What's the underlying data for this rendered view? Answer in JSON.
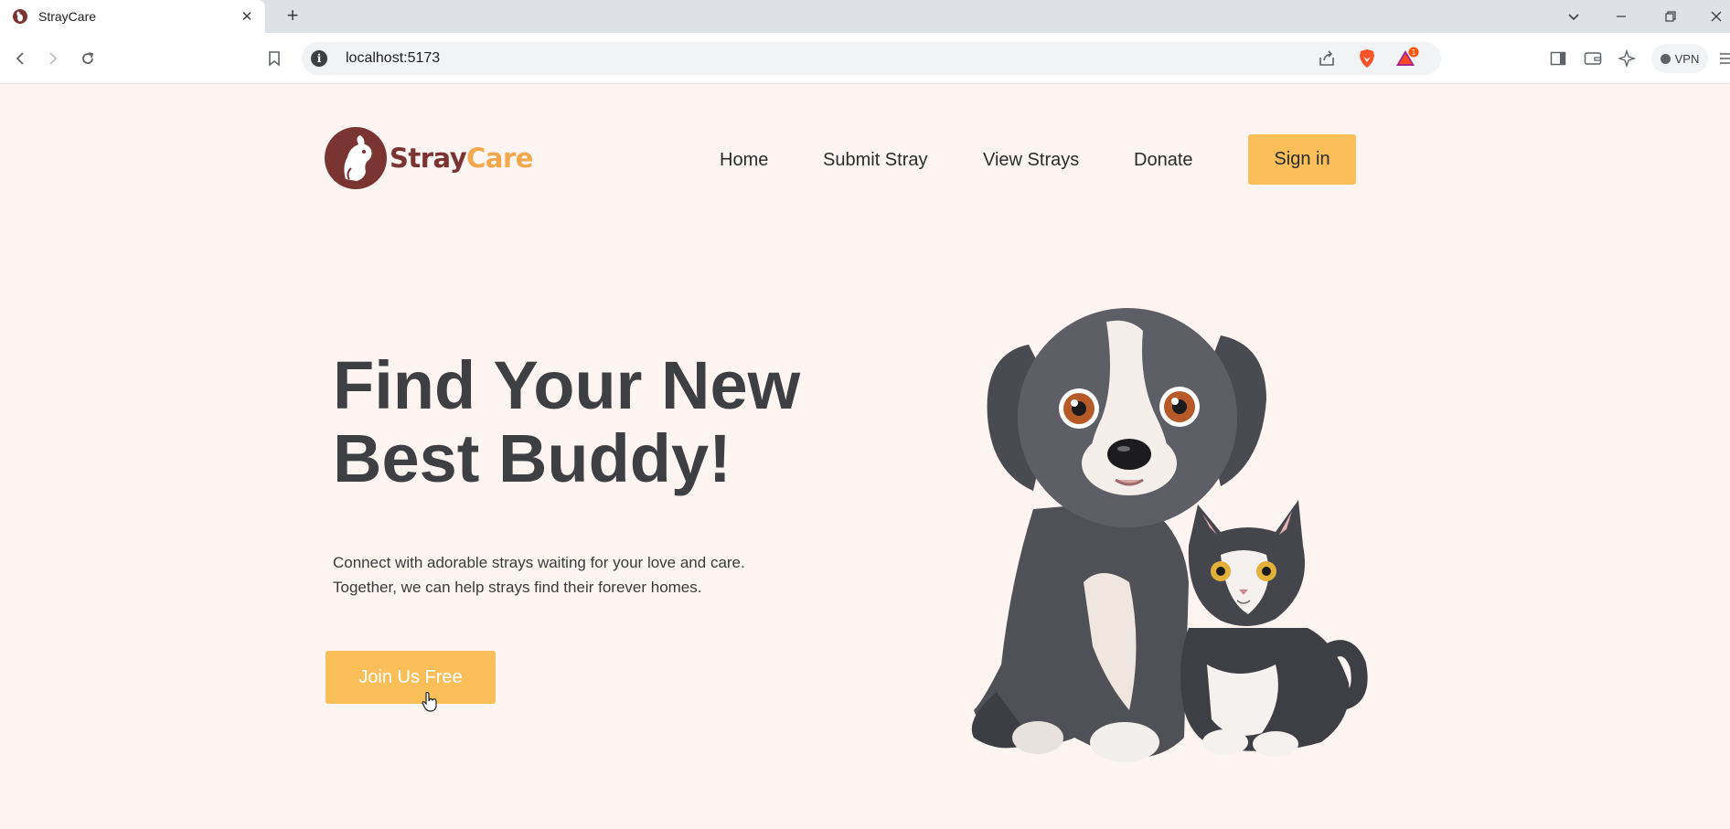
{
  "browser": {
    "tab_title": "StrayCare",
    "url": "localhost:5173",
    "vpn_label": "VPN",
    "icons": [
      "back-icon",
      "forward-icon",
      "reload-icon",
      "bookmark-icon",
      "share-icon",
      "brave-shield-icon",
      "brave-rewards-icon",
      "sidebar-icon",
      "wallet-icon",
      "leo-icon",
      "menu-icon"
    ]
  },
  "header": {
    "logo_part1": "Stray",
    "logo_part2": "Care",
    "nav": [
      "Home",
      "Submit Stray",
      "View Strays",
      "Donate"
    ],
    "signin_label": "Sign in"
  },
  "hero": {
    "title_line1": "Find Your New",
    "title_line2": "Best Buddy!",
    "subtitle_line1": "Connect with adorable strays waiting for your love and care.",
    "subtitle_line2": "Together, we can help strays find their forever homes.",
    "cta_label": "Join Us Free"
  },
  "colors": {
    "page_bg": "#fef4f1",
    "accent": "#fbbf5a",
    "logo_primary": "#7a3533",
    "logo_secondary": "#f2a84b",
    "heading": "#3e3f42"
  }
}
